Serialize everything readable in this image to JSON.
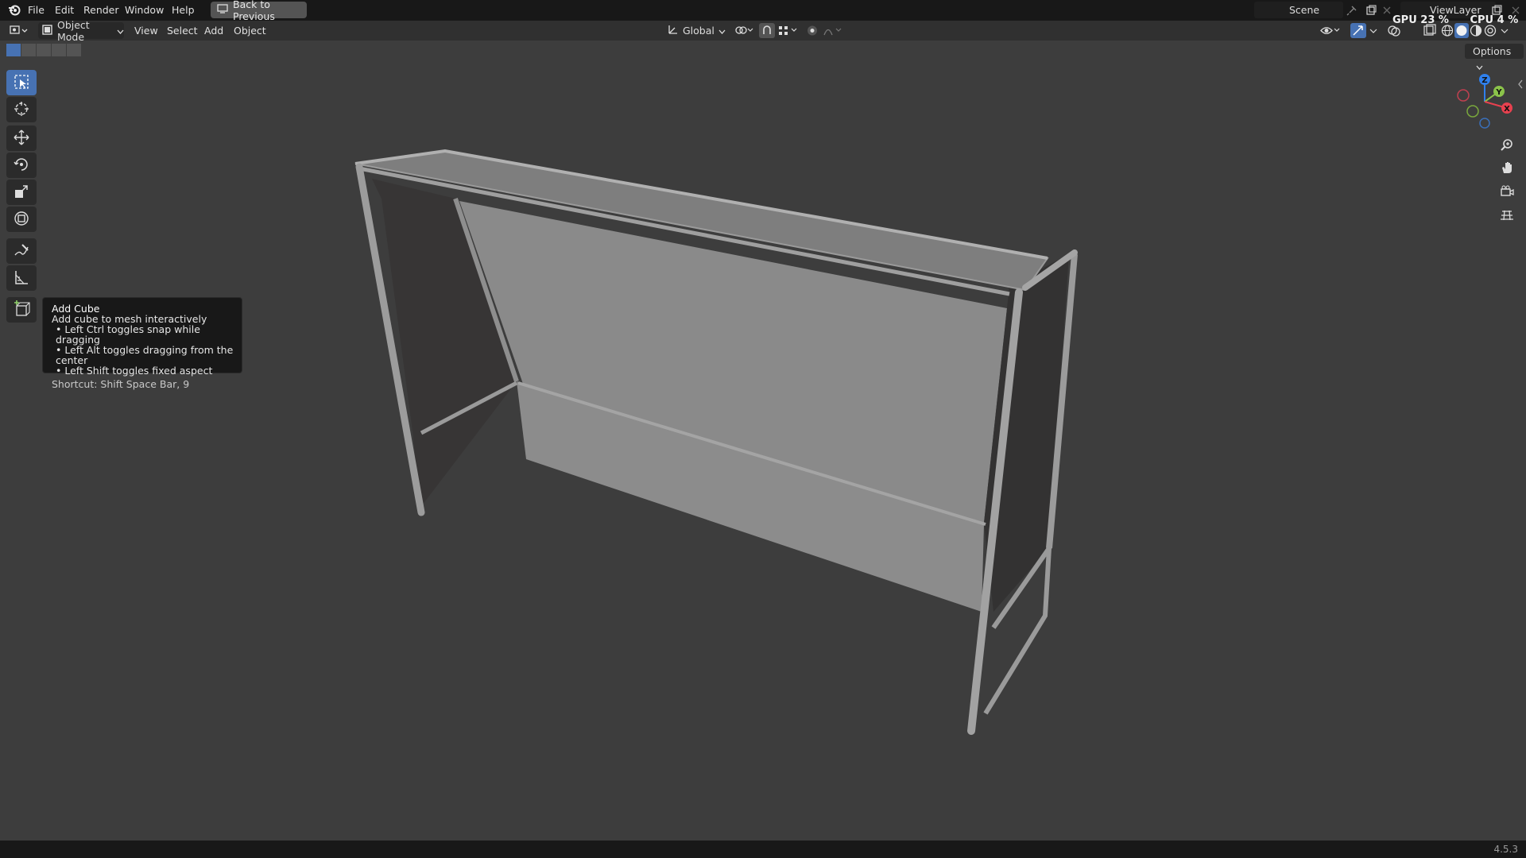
{
  "menu": {
    "items": [
      "File",
      "Edit",
      "Render",
      "Window",
      "Help"
    ],
    "back_button": "Back to Previous"
  },
  "scene": {
    "label": "Scene"
  },
  "view_layer": {
    "label": "ViewLayer"
  },
  "stats": {
    "gpu": "GPU 23 %",
    "cpu": "CPU 4 %"
  },
  "header": {
    "mode": "Object Mode",
    "menus": [
      "View",
      "Select",
      "Add",
      "Object"
    ],
    "orientation": "Global",
    "options": "Options"
  },
  "tooltip": {
    "title": "Add Cube",
    "description": "Add cube to mesh interactively",
    "bullets": [
      "• Left Ctrl toggles snap while dragging",
      "• Left Alt toggles dragging from the center",
      "• Left Shift toggles fixed aspect"
    ],
    "shortcut": "Shortcut: Shift Space Bar, 9"
  },
  "gizmo": {
    "z": "Z",
    "y": "Y",
    "x": "X"
  },
  "colors": {
    "accent": "#4772b3",
    "background": "#3d3d3d",
    "axis_x": "#e8414f",
    "axis_y": "#8bc34a",
    "axis_z": "#2f80ed"
  },
  "status": {
    "version": "4.5.3"
  }
}
